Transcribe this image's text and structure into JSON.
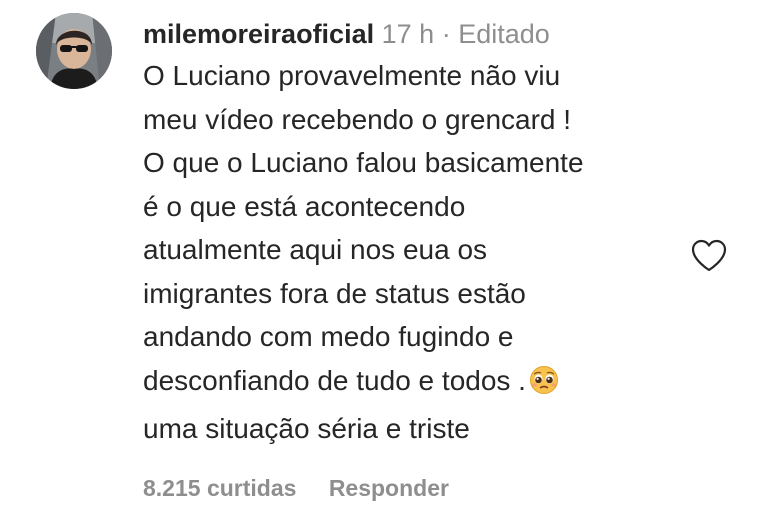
{
  "comment": {
    "username": "milemoreiraoficial",
    "time": "17 h",
    "separator": " · ",
    "edited": "Editado",
    "lines": [
      "O Luciano provavelmente não viu",
      "meu vídeo recebendo o grencard !",
      "O que o Luciano falou basicamente",
      "é o que está acontecendo",
      "atualmente aqui nos eua os",
      "imigrantes fora de status estão",
      "andando com medo fugindo e",
      "desconfiando de tudo e todos .",
      "uma situação séria e triste"
    ],
    "emoji": "pleading-face-emoji",
    "likes": "8.215 curtidas",
    "reply": "Responder",
    "icons": {
      "like": "heart-outline-icon"
    }
  }
}
